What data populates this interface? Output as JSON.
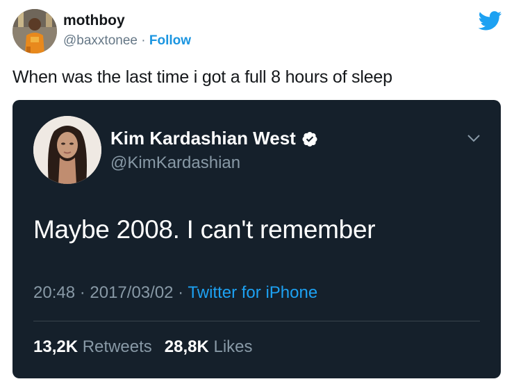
{
  "outer_tweet": {
    "display_name": "mothboy",
    "handle": "@baxxtonee",
    "separator": " · ",
    "follow_label": "Follow",
    "text": "When was the last time i got a full 8 hours of sleep",
    "logo_icon": "twitter-bird-icon"
  },
  "embedded_tweet": {
    "display_name": "Kim Kardashian West",
    "verified_icon": "verified-badge-icon",
    "handle": "@KimKardashian",
    "text": "Maybe 2008. I can't remember",
    "time": "20:48",
    "date": "2017/03/02",
    "source": "Twitter for iPhone",
    "meta_sep": " · ",
    "retweets_count": "13,2K",
    "retweets_label": "Retweets",
    "likes_count": "28,8K",
    "likes_label": "Likes"
  },
  "colors": {
    "card_bg": "#15202b",
    "link_blue": "#1da1f2",
    "follow_blue": "#1b95e0",
    "muted": "#8899a6",
    "twitter_brand": "#1da1f2"
  }
}
